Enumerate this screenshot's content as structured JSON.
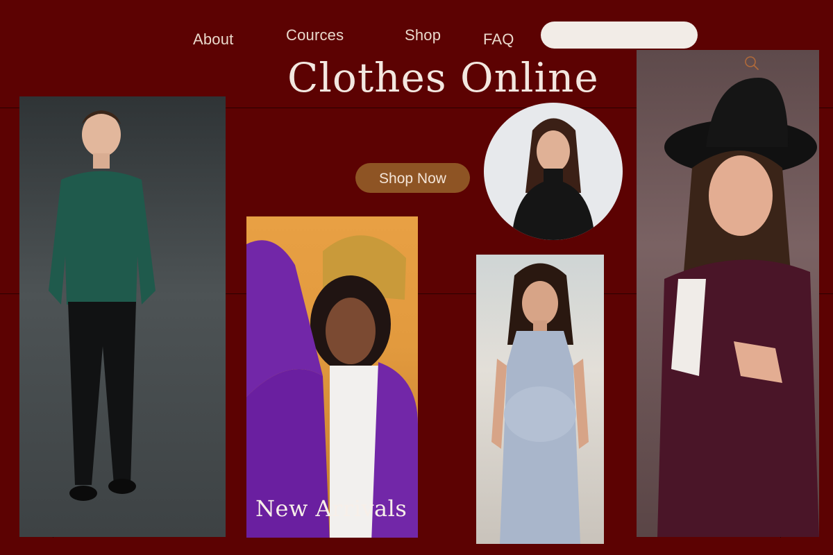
{
  "nav": {
    "about": "About",
    "cources": "Cources",
    "shop": "Shop",
    "faq": "FAQ"
  },
  "search": {
    "value": "",
    "placeholder": "",
    "icon": "search-icon"
  },
  "hero": {
    "title": "Clothes Online",
    "cta_label": "Shop Now"
  },
  "gallery": {
    "caption": "New Arrivals"
  },
  "colors": {
    "background": "#5c0202",
    "cta": "#8e5424",
    "text": "#f3e7e0",
    "search_bg": "#f2ece7",
    "search_icon": "#b06a3a"
  }
}
